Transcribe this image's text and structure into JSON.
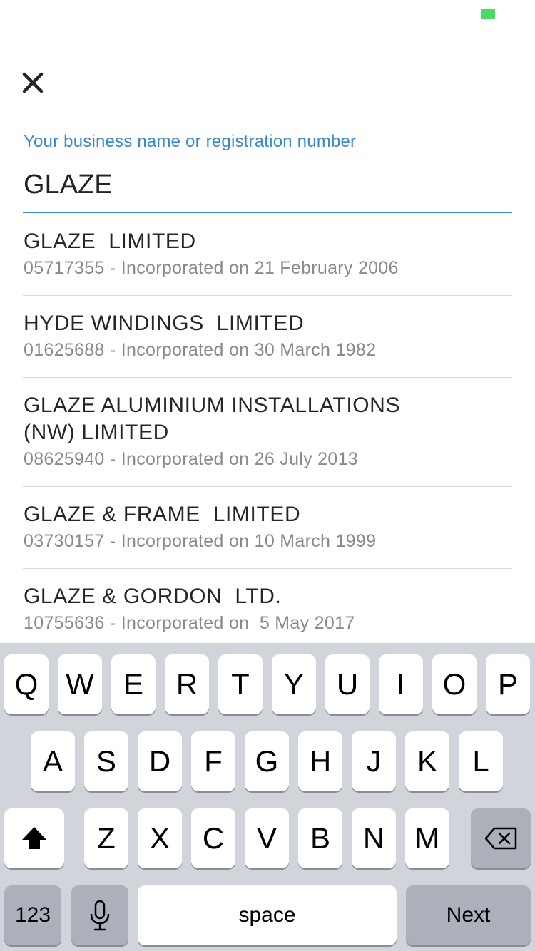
{
  "close": {
    "icon": "close-icon"
  },
  "search": {
    "label": "Your business name or registration number",
    "value": "GLAZE"
  },
  "results": [
    {
      "name": "GLAZE  LIMITED",
      "meta": "05717355 - Incorporated on 21 February 2006"
    },
    {
      "name": "HYDE WINDINGS  LIMITED",
      "meta": "01625688 - Incorporated on 30 March 1982"
    },
    {
      "name": "GLAZE ALUMINIUM INSTALLATIONS (NW) LIMITED",
      "meta": "08625940 - Incorporated on 26 July 2013"
    },
    {
      "name": "GLAZE & FRAME  LIMITED",
      "meta": "03730157 - Incorporated on 10 March 1999"
    },
    {
      "name": "GLAZE & GORDON  LTD.",
      "meta": "10755636 - Incorporated on  5 May 2017"
    }
  ],
  "keyboard": {
    "row1": [
      "Q",
      "W",
      "E",
      "R",
      "T",
      "Y",
      "U",
      "I",
      "O",
      "P"
    ],
    "row2": [
      "A",
      "S",
      "D",
      "F",
      "G",
      "H",
      "J",
      "K",
      "L"
    ],
    "row3": [
      "Z",
      "X",
      "C",
      "V",
      "B",
      "N",
      "M"
    ],
    "numbers_label": "123",
    "space_label": "space",
    "next_label": "Next",
    "shift_icon": "shift-icon",
    "delete_icon": "backspace-icon",
    "mic_icon": "microphone-icon"
  },
  "colors": {
    "accent": "#3a87cf",
    "battery": "#4cd964",
    "keyboard_bg": "#d1d5db",
    "key_dark": "#abb0ba"
  }
}
